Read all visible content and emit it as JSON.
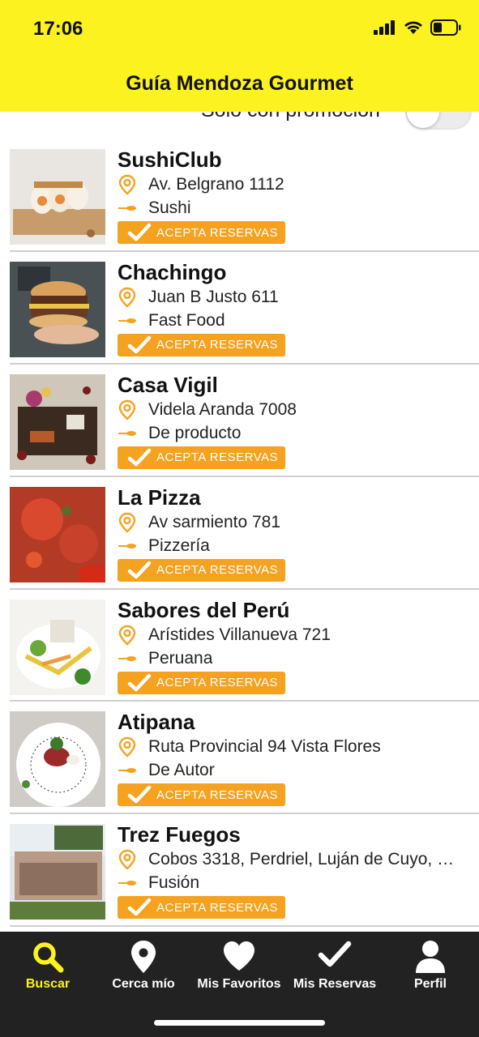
{
  "status": {
    "time": "17:06"
  },
  "header": {
    "title": "Guía Mendoza Gourmet"
  },
  "filter": {
    "label": "Solo con promoción",
    "enabled": false
  },
  "restaurants": [
    {
      "name": "SushiClub",
      "address": "Av. Belgrano 1112",
      "category": "Sushi",
      "badge": "ACEPTA RESERVAS",
      "image": "sushi"
    },
    {
      "name": "Chachingo",
      "address": "Juan B Justo 611",
      "category": "Fast Food",
      "badge": "ACEPTA RESERVAS",
      "image": "burger"
    },
    {
      "name": "Casa Vigil",
      "address": "Videla Aranda 7008",
      "category": "De producto",
      "badge": "ACEPTA RESERVAS",
      "image": "table"
    },
    {
      "name": "La Pizza",
      "address": "Av sarmiento 781",
      "category": "Pizzería",
      "badge": "ACEPTA RESERVAS",
      "image": "pizza"
    },
    {
      "name": "Sabores del Perú",
      "address": "Arístides Villanueva 721",
      "category": "Peruana",
      "badge": "ACEPTA RESERVAS",
      "image": "salad"
    },
    {
      "name": "Atipana",
      "address": "Ruta Provincial 94  Vista Flores",
      "category": "De Autor",
      "badge": "ACEPTA RESERVAS",
      "image": "plate"
    },
    {
      "name": "Trez Fuegos",
      "address": "Cobos 3318, Perdriel, Luján de Cuyo, M...",
      "category": "Fusión",
      "badge": "ACEPTA RESERVAS",
      "image": "building"
    }
  ],
  "tabs": [
    {
      "label": "Buscar",
      "icon": "search-icon",
      "active": true
    },
    {
      "label": "Cerca mío",
      "icon": "location-pin-icon",
      "active": false
    },
    {
      "label": "Mis Favoritos",
      "icon": "heart-icon",
      "active": false
    },
    {
      "label": "Mis Reservas",
      "icon": "checkmark-icon",
      "active": false
    },
    {
      "label": "Perfil",
      "icon": "user-icon",
      "active": false
    }
  ],
  "colors": {
    "header": "#fcf21f",
    "accent": "#f4a21f",
    "tabbar": "#222222",
    "active_tab": "#fcf21f"
  }
}
